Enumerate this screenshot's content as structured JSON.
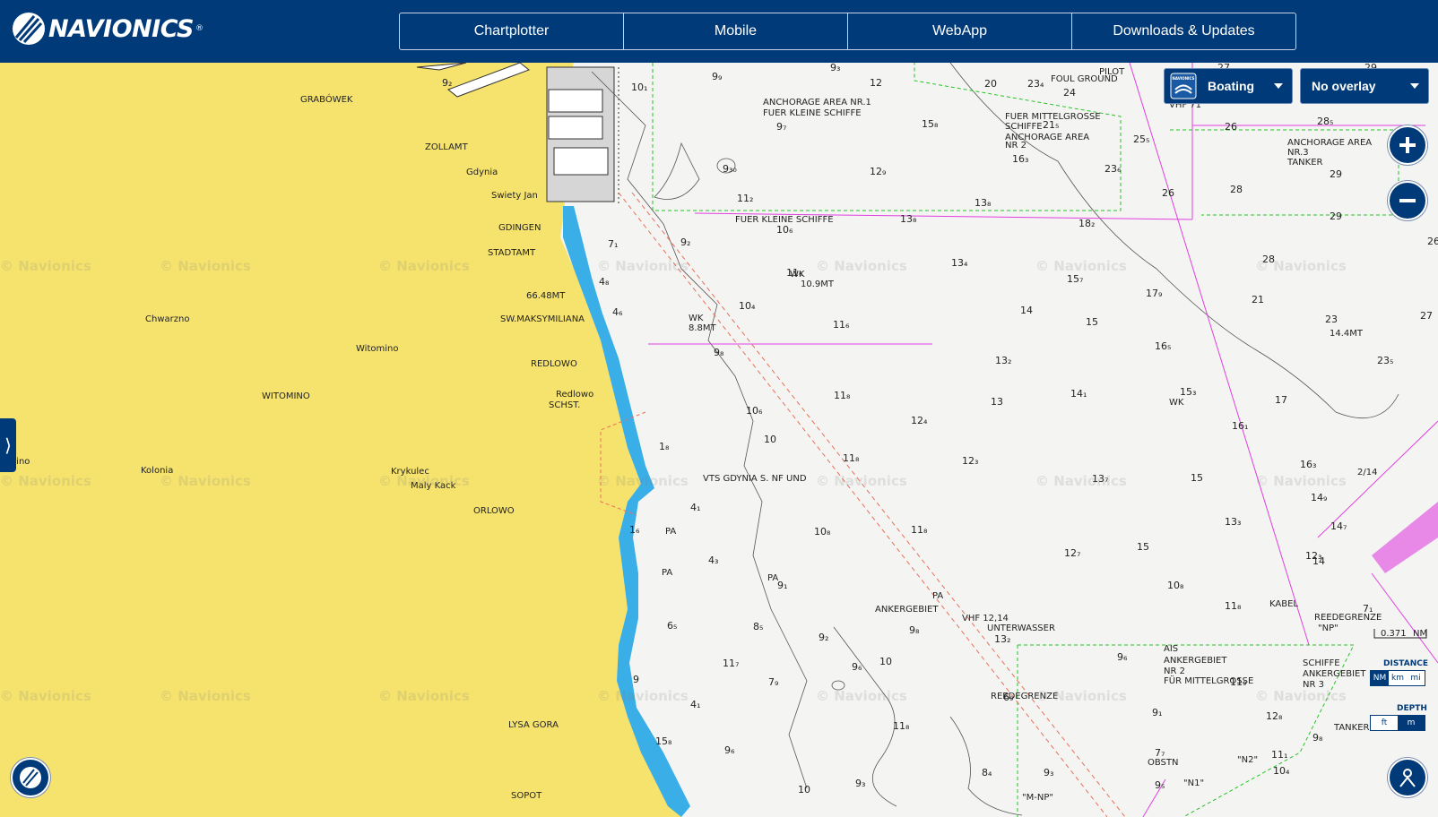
{
  "brand": {
    "name": "NAVIONICS",
    "registered": "®"
  },
  "nav": {
    "tabs": [
      "Chartplotter",
      "Mobile",
      "WebApp",
      "Downloads & Updates"
    ]
  },
  "mode_dropdown": {
    "brand": "NAVIONICS",
    "label": "Boating"
  },
  "overlay_dropdown": {
    "label": "No overlay"
  },
  "scale": {
    "value": "0.371",
    "unit": "NM"
  },
  "distance": {
    "title": "DISTANCE",
    "options": [
      "NM",
      "km",
      "mi"
    ],
    "selected": "NM"
  },
  "depth": {
    "title": "DEPTH",
    "options": [
      "ft",
      "m"
    ],
    "selected": "m"
  },
  "watermark": "© Navionics",
  "land_labels": [
    {
      "text": "GRABÓWEK"
    },
    {
      "text": "ZOLLAMT"
    },
    {
      "text": "Gdynia"
    },
    {
      "text": "Swiety Jan"
    },
    {
      "text": "GDINGEN"
    },
    {
      "text": "STADTAMT"
    },
    {
      "text": "66.48MT"
    },
    {
      "text": "SW.MAKSYMILIANA"
    },
    {
      "text": "Chwarzno"
    },
    {
      "text": "Witomino"
    },
    {
      "text": "REDLOWO"
    },
    {
      "text": "Redlowo"
    },
    {
      "text": "SCHST."
    },
    {
      "text": "WITOMINO"
    },
    {
      "text": "Kolonia"
    },
    {
      "text": "Krykulec"
    },
    {
      "text": "Maly Kack"
    },
    {
      "text": "ORLOWO"
    },
    {
      "text": "LYSA GORA"
    },
    {
      "text": "SOPOT"
    },
    {
      "text": "ezlino"
    }
  ],
  "sea_labels": [
    {
      "text": "ANCHORAGE AREA NR.1"
    },
    {
      "text": "FUER KLEINE SCHIFFE"
    },
    {
      "text": "FOUL GROUND"
    },
    {
      "text": "PILOT"
    },
    {
      "text": "FUER MITTELGROSSE"
    },
    {
      "text": "SCHIFFE"
    },
    {
      "text": "ANCHORAGE AREA"
    },
    {
      "text": "NR 2"
    },
    {
      "text": "VHF 71"
    },
    {
      "text": "ANCHORAGE AREA"
    },
    {
      "text": "NR.3"
    },
    {
      "text": "TANKER"
    },
    {
      "text": "FUER KLEINE SCHIFFE"
    },
    {
      "text": "WK"
    },
    {
      "text": "10.9MT"
    },
    {
      "text": "WK"
    },
    {
      "text": "8.8MT"
    },
    {
      "text": "WK"
    },
    {
      "text": "14.4MT"
    },
    {
      "text": "VTS GDYNIA S. NF UND"
    },
    {
      "text": "PA"
    },
    {
      "text": "PA"
    },
    {
      "text": "PA"
    },
    {
      "text": "PA"
    },
    {
      "text": "VHF 12,14"
    },
    {
      "text": "UNTERWASSER"
    },
    {
      "text": "KABEL"
    },
    {
      "text": "REEDEGRENZE"
    },
    {
      "text": "REEDEGRENZE"
    },
    {
      "text": "\"NP\""
    },
    {
      "text": "AIS"
    },
    {
      "text": "ANKERGEBIET"
    },
    {
      "text": "NR 2"
    },
    {
      "text": "FÜR MITTELGROSSE"
    },
    {
      "text": "SCHIFFE"
    },
    {
      "text": "ANKERGEBIET"
    },
    {
      "text": "NR 3"
    },
    {
      "text": "TANKER"
    },
    {
      "text": "OBSTN"
    },
    {
      "text": "\"N1\""
    },
    {
      "text": "\"N2\""
    },
    {
      "text": "\"M-NP\""
    },
    {
      "text": "ANKERGEBIET"
    },
    {
      "text": "2/14"
    },
    {
      "text": "WK"
    }
  ],
  "depths": [
    {
      "t": "9₂"
    },
    {
      "t": "9₃"
    },
    {
      "t": "10₁"
    },
    {
      "t": "9₉"
    },
    {
      "t": "12"
    },
    {
      "t": "20"
    },
    {
      "t": "23₄"
    },
    {
      "t": "24"
    },
    {
      "t": "29"
    },
    {
      "t": "27"
    },
    {
      "t": "15₈"
    },
    {
      "t": "21₅"
    },
    {
      "t": "25₅"
    },
    {
      "t": "26"
    },
    {
      "t": "28₅"
    },
    {
      "t": "9₇"
    },
    {
      "t": "9₃₀"
    },
    {
      "t": "12₉"
    },
    {
      "t": "16₃"
    },
    {
      "t": "23₆"
    },
    {
      "t": "29"
    },
    {
      "t": "28"
    },
    {
      "t": "11₂"
    },
    {
      "t": "13₈"
    },
    {
      "t": "26"
    },
    {
      "t": "29"
    },
    {
      "t": "10₆"
    },
    {
      "t": "13₈"
    },
    {
      "t": "18₂"
    },
    {
      "t": "7₁"
    },
    {
      "t": "9₂"
    },
    {
      "t": "26"
    },
    {
      "t": "11₆"
    },
    {
      "t": "13₄"
    },
    {
      "t": "28"
    },
    {
      "t": "4₈"
    },
    {
      "t": "15₇"
    },
    {
      "t": "17₉"
    },
    {
      "t": "21"
    },
    {
      "t": "4₆"
    },
    {
      "t": "10₄"
    },
    {
      "t": "14"
    },
    {
      "t": "27"
    },
    {
      "t": "11₆"
    },
    {
      "t": "15"
    },
    {
      "t": "23"
    },
    {
      "t": "16₅"
    },
    {
      "t": "9₈"
    },
    {
      "t": "13₂"
    },
    {
      "t": "23₅"
    },
    {
      "t": "11₈"
    },
    {
      "t": "14₁"
    },
    {
      "t": "15₃"
    },
    {
      "t": "13"
    },
    {
      "t": "17"
    },
    {
      "t": "10₆"
    },
    {
      "t": "12₄"
    },
    {
      "t": "16₁"
    },
    {
      "t": "10"
    },
    {
      "t": "11₈"
    },
    {
      "t": "12₃"
    },
    {
      "t": "16₃"
    },
    {
      "t": "13₇"
    },
    {
      "t": "15"
    },
    {
      "t": "14₉"
    },
    {
      "t": "1₈"
    },
    {
      "t": "4₁"
    },
    {
      "t": "13₃"
    },
    {
      "t": "14₇"
    },
    {
      "t": "10₈"
    },
    {
      "t": "11₈"
    },
    {
      "t": "1₆"
    },
    {
      "t": "15"
    },
    {
      "t": "4₃"
    },
    {
      "t": "12₇"
    },
    {
      "t": "12₃"
    },
    {
      "t": "14"
    },
    {
      "t": "10₈"
    },
    {
      "t": "9₁"
    },
    {
      "t": "7₁"
    },
    {
      "t": "11₈"
    },
    {
      "t": "6₅"
    },
    {
      "t": "8₅"
    },
    {
      "t": "9₈"
    },
    {
      "t": "13₂"
    },
    {
      "t": "9₂"
    },
    {
      "t": "9₆"
    },
    {
      "t": "10"
    },
    {
      "t": "9₆"
    },
    {
      "t": "11₉"
    },
    {
      "t": "11₇"
    },
    {
      "t": "7₉"
    },
    {
      "t": "9"
    },
    {
      "t": "4₁"
    },
    {
      "t": "6₉"
    },
    {
      "t": "9₁"
    },
    {
      "t": "12₈"
    },
    {
      "t": "11₈"
    },
    {
      "t": "9₈"
    },
    {
      "t": "15₈"
    },
    {
      "t": "9₆"
    },
    {
      "t": "7₇"
    },
    {
      "t": "11₁"
    },
    {
      "t": "10"
    },
    {
      "t": "8₄"
    },
    {
      "t": "9₃"
    },
    {
      "t": "9₃"
    },
    {
      "t": "9₅"
    },
    {
      "t": "10₄"
    },
    {
      "t": "8₆"
    },
    {
      "t": "10"
    }
  ]
}
